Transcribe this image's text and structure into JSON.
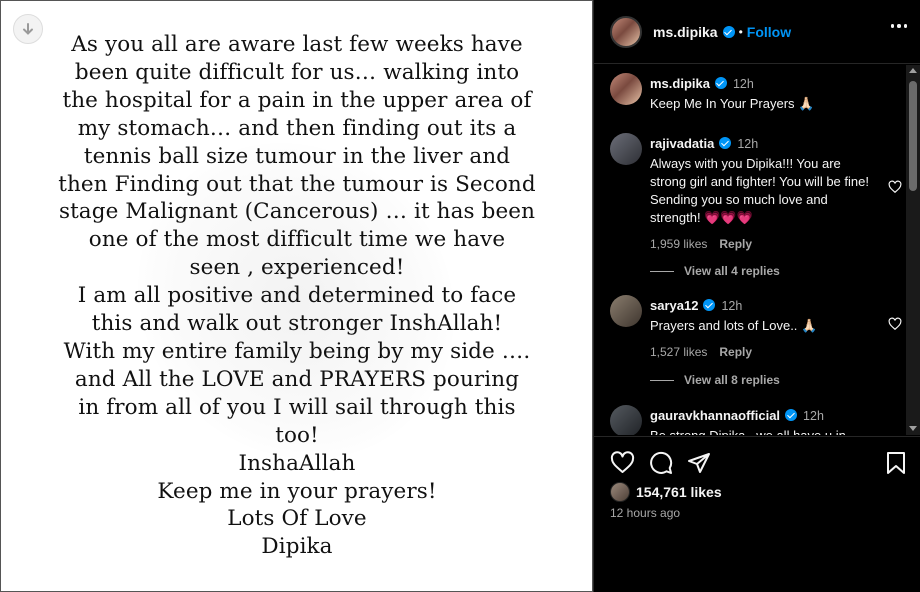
{
  "post": {
    "lines": [
      "As you all are aware last few weeks have",
      "been quite difficult for us… walking into",
      "the hospital for a pain in the upper area of",
      "my stomach… and then finding out its a",
      "tennis ball size tumour in the liver and",
      "then Finding out that the tumour is Second",
      "stage Malignant (Cancerous) … it has been",
      "one of the most difficult time we have",
      "seen , experienced!",
      " I am all positive and determined to face",
      "this and walk out stronger InshAllah!",
      "With my entire family being by my side ….",
      "and All the LOVE and PRAYERS pouring",
      "in from all of you I will sail through this",
      "too!",
      "InshaAllah",
      "Keep me in your prayers!",
      "Lots Of Love",
      "Dipika"
    ]
  },
  "header": {
    "username": "ms.dipika",
    "separator": "•",
    "follow_label": "Follow"
  },
  "caption": {
    "username": "ms.dipika",
    "time": "12h",
    "text": "Keep Me In Your Prayers 🙏🏻"
  },
  "comments": [
    {
      "username": "rajivadatia",
      "time": "12h",
      "text": "Always with you Dipika!!! You are strong girl and fighter! You will be fine! Sending you so much love and strength! 💗💗💗",
      "likes": "1,959 likes",
      "reply_label": "Reply",
      "view_replies": "View all 4 replies"
    },
    {
      "username": "sarya12",
      "time": "12h",
      "text": "Prayers and lots of Love.. 🙏🏻",
      "likes": "1,527 likes",
      "reply_label": "Reply",
      "view_replies": "View all 8 replies"
    },
    {
      "username": "gauravkhannaofficial",
      "time": "12h",
      "text": "Be strong Dipika.. we all have u in"
    }
  ],
  "footer": {
    "likes_count": "154,761 likes",
    "posted_time": "12 hours ago"
  },
  "icons": {
    "download": "arrow-down-icon",
    "more": "more-horizontal-icon",
    "like": "heart-icon",
    "comment": "comment-icon",
    "share": "share-icon",
    "save": "bookmark-icon"
  },
  "colors": {
    "accent": "#0095f6",
    "panel_bg": "#000000",
    "muted": "#a8a8a8"
  }
}
